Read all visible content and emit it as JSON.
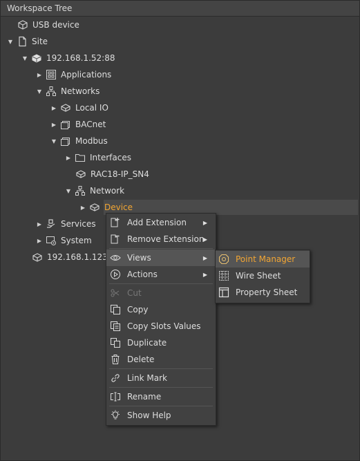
{
  "panel": {
    "title": "Workspace Tree"
  },
  "tree": {
    "usb_device": "USB device",
    "site": "Site",
    "host1": "192.168.1.52:88",
    "applications": "Applications",
    "networks": "Networks",
    "local_io": "Local IO",
    "bacnet": "BACnet",
    "modbus": "Modbus",
    "interfaces": "Interfaces",
    "rac18": "RAC18-IP_SN4",
    "network": "Network",
    "device": "Device",
    "services": "Services",
    "system": "System",
    "host2": "192.168.1.123:"
  },
  "context_menu": {
    "add_extension": "Add Extension",
    "remove_extension": "Remove Extension",
    "views": "Views",
    "actions": "Actions",
    "cut": "Cut",
    "copy": "Copy",
    "copy_slots": "Copy Slots Values",
    "duplicate": "Duplicate",
    "delete": "Delete",
    "link_mark": "Link Mark",
    "rename": "Rename",
    "show_help": "Show Help"
  },
  "views_submenu": {
    "point_manager": "Point Manager",
    "wire_sheet": "Wire Sheet",
    "property_sheet": "Property Sheet"
  },
  "colors": {
    "accent": "#f1a533",
    "background": "#3c3c3c"
  }
}
